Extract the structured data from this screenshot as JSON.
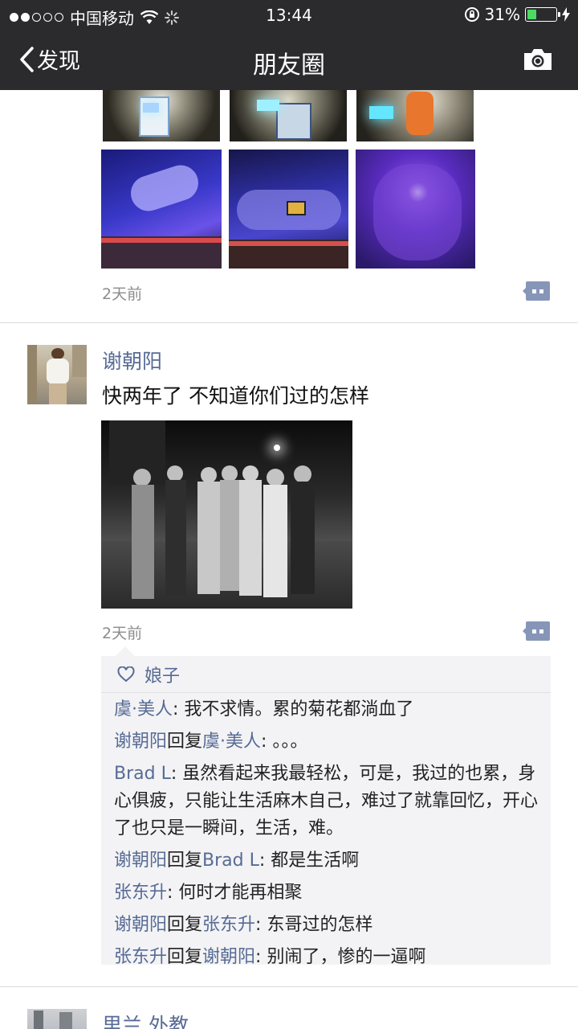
{
  "status_bar": {
    "carrier": "中国移动",
    "time": "13:44",
    "battery": "31%",
    "battery_level": 0.31
  },
  "nav": {
    "back_label": "发现",
    "title": "朋友圈"
  },
  "post1": {
    "time": "2天前"
  },
  "post2": {
    "author": "谢朝阳",
    "text": "快两年了 不知道你们过的怎样",
    "time": "2天前",
    "likes": [
      "娘子"
    ],
    "comments": [
      {
        "from": "虞·美人",
        "to": "",
        "text": "我不求情。累的菊花都淌血了"
      },
      {
        "from": "谢朝阳",
        "to": "虞·美人",
        "text": "。。。"
      },
      {
        "from": "Brad L",
        "to": "",
        "text": "虽然看起来我最轻松，可是，我过的也累，身心俱疲，只能让生活麻木自己，难过了就靠回忆，开心了也只是一瞬间，生活，难。"
      },
      {
        "from": "谢朝阳",
        "to": "Brad L",
        "text": "都是生活啊"
      },
      {
        "from": "张东升",
        "to": "",
        "text": "何时才能再相聚"
      },
      {
        "from": "谢朝阳",
        "to": "张东升",
        "text": "东哥过的怎样"
      },
      {
        "from": "张东升",
        "to": "谢朝阳",
        "text": "别闹了，惨的一逼啊"
      }
    ],
    "reply_word": "回复"
  },
  "post3": {
    "author": "里兰 外教"
  },
  "colors": {
    "nav_bg": "#2b2b2d",
    "link": "#576b95",
    "comment_bg": "#f3f3f5",
    "battery": "#4cd964"
  }
}
